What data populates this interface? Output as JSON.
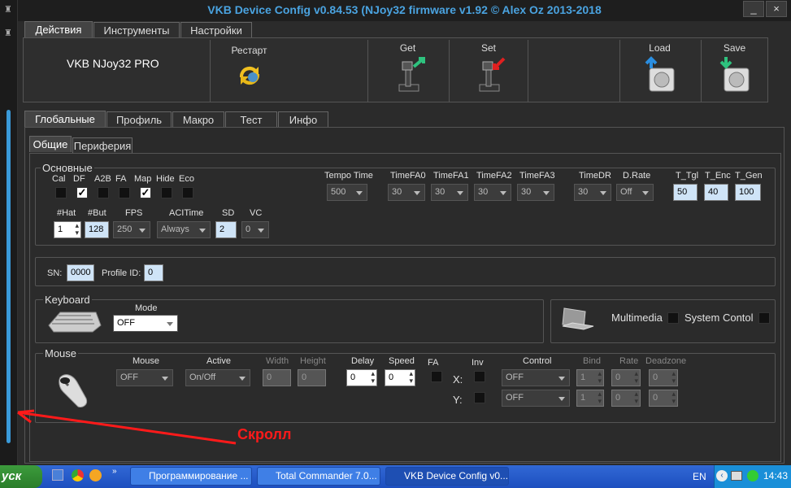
{
  "window": {
    "title": "VKB Device Config v0.84.53 (NJoy32 firmware v1.92 © Alex Oz 2013-2018",
    "min": "_",
    "close": "×"
  },
  "main_tabs": [
    "Действия",
    "Инструменты",
    "Настройки"
  ],
  "device_name": "VKB NJoy32 PRO",
  "actions": {
    "restart": "Рестарт",
    "get": "Get",
    "set": "Set",
    "load": "Load",
    "save": "Save"
  },
  "sub_tabs": [
    "Глобальные",
    "Профиль",
    "Макро",
    "Тест",
    "Инфо"
  ],
  "inner_tabs": [
    "Общие",
    "Периферия"
  ],
  "basic": {
    "title": "Основные",
    "flags": [
      {
        "label": "Cal",
        "on": false
      },
      {
        "label": "DF",
        "on": true
      },
      {
        "label": "A2B",
        "on": false
      },
      {
        "label": "FA",
        "on": false
      },
      {
        "label": "Map",
        "on": true
      },
      {
        "label": "Hide",
        "on": false
      },
      {
        "label": "Eco",
        "on": false
      }
    ],
    "tempo": {
      "label": "Tempo Time",
      "value": "500"
    },
    "timefa": [
      {
        "label": "TimeFA0",
        "value": "30"
      },
      {
        "label": "TimeFA1",
        "value": "30"
      },
      {
        "label": "TimeFA2",
        "value": "30"
      },
      {
        "label": "TimeFA3",
        "value": "30"
      }
    ],
    "timedr": {
      "label": "TimeDR",
      "value": "30"
    },
    "drate": {
      "label": "D.Rate",
      "value": "Off"
    },
    "t_tgl": {
      "label": "T_Tgl",
      "value": "50"
    },
    "t_enc": {
      "label": "T_Enc",
      "value": "40"
    },
    "t_gen": {
      "label": "T_Gen",
      "value": "100"
    },
    "hat": {
      "label": "#Hat",
      "value": "1"
    },
    "but": {
      "label": "#But",
      "value": "128"
    },
    "fps": {
      "label": "FPS",
      "value": "250"
    },
    "acitime": {
      "label": "ACITime",
      "value": "Always"
    },
    "sd": {
      "label": "SD",
      "value": "2"
    },
    "vc": {
      "label": "VC",
      "value": "0"
    }
  },
  "sn": {
    "label": "SN:",
    "value": "0000"
  },
  "profile_id": {
    "label": "Profile ID:",
    "value": "0"
  },
  "keyboard": {
    "title": "Keyboard",
    "mode_label": "Mode",
    "mode": "OFF"
  },
  "multimedia": {
    "label": "Multimedia"
  },
  "system_control": {
    "label": "System Contol"
  },
  "mouse": {
    "title": "Mouse",
    "headers": {
      "mouse": "Mouse",
      "active": "Active",
      "width": "Width",
      "height": "Height",
      "delay": "Delay",
      "speed": "Speed",
      "fa": "FA",
      "inv": "Inv",
      "control": "Control",
      "bind": "Bind",
      "rate": "Rate",
      "deadzone": "Deadzone"
    },
    "mouse": "OFF",
    "active": "On/Off",
    "width": "0",
    "height": "0",
    "delay": "0",
    "speed": "0",
    "x_label": "X:",
    "y_label": "Y:",
    "x": {
      "control": "OFF",
      "bind": "1",
      "rate": "0",
      "deadzone": "0"
    },
    "y": {
      "control": "OFF",
      "bind": "1",
      "rate": "0",
      "deadzone": "0"
    }
  },
  "annotation": {
    "text": "Скролл",
    "color": "#ff1a1a"
  },
  "taskbar": {
    "start": "уск",
    "items": [
      "Программирование ...",
      "Total Commander 7.0...",
      "VKB Device Config v0..."
    ],
    "lang": "EN",
    "clock": "14:43"
  }
}
